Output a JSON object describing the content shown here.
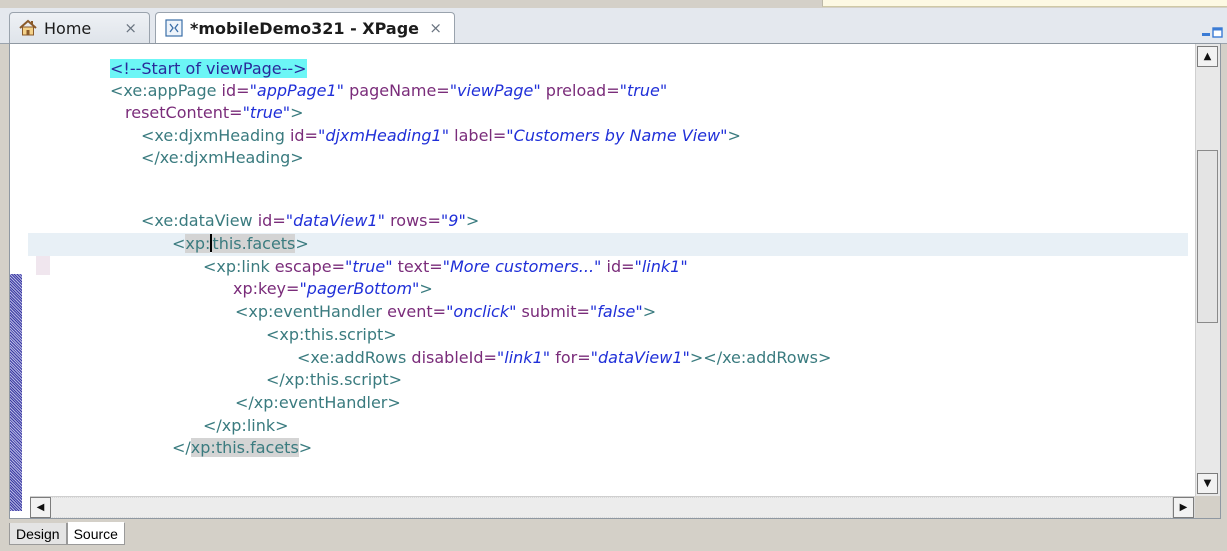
{
  "tabs": [
    {
      "label": "Home",
      "icon": "home-icon",
      "close": "×"
    },
    {
      "label": "*mobileDemo321 - XPage",
      "icon": "xpage-icon",
      "close": "×"
    }
  ],
  "code": {
    "line1": {
      "comment": "<!--Start of viewPage-->"
    },
    "line2": {
      "t1": "<xe:appPage",
      "a1": " id=",
      "v1": "\"appPage1\"",
      "a2": " pageName=",
      "v2": "\"viewPage\"",
      "a3": " preload=",
      "v3": "\"true\""
    },
    "line3": {
      "a1": "resetContent=",
      "v1": "\"true\"",
      "t1": ">"
    },
    "line4": {
      "t1": "<xe:djxmHeading",
      "a1": " id=",
      "v1": "\"djxmHeading1\"",
      "a2": " label=",
      "v2": "\"Customers by Name View\"",
      "t2": ">"
    },
    "line5": {
      "t1": "</xe:djxmHeading>"
    },
    "line7": {
      "t1": "<xe:dataView",
      "a1": " id=",
      "v1": "\"dataView1\"",
      "a2": " rows=",
      "v2": "\"9\"",
      "t2": ">"
    },
    "line8": {
      "t1": "<",
      "h1a": "xp:",
      "h1b": "this.facets",
      "t2": ">"
    },
    "line9": {
      "t1": "<xp:link",
      "a1": " escape=",
      "v1": "\"true\"",
      "a2": " text=",
      "v2": "\"More customers...\"",
      "a3": " id=",
      "v3": "\"link1\""
    },
    "line10": {
      "a1": "xp:key=",
      "v1": "\"pagerBottom\"",
      "t1": ">"
    },
    "line11": {
      "t1": "<xp:eventHandler",
      "a1": " event=",
      "v1": "\"onclick\"",
      "a2": " submit=",
      "v2": "\"false\"",
      "t2": ">"
    },
    "line12": {
      "t1": "<xp:this.script>"
    },
    "line13": {
      "t1": "<xe:addRows",
      "a1": " disableId=",
      "v1": "\"link1\"",
      "a2": " for=",
      "v2": "\"dataView1\"",
      "t2": "></xe:addRows>"
    },
    "line14": {
      "t1": "</xp:this.script>"
    },
    "line15": {
      "t1": "</xp:eventHandler>"
    },
    "line16": {
      "t1": "</xp:link>"
    },
    "line17": {
      "t1": "</",
      "h1": "xp:this.facets",
      "t2": ">"
    }
  },
  "scroll": {
    "up": "▲",
    "down": "▼",
    "left": "◀",
    "right": "▶"
  },
  "bottom_tabs": {
    "design": "Design",
    "source": "Source"
  },
  "colors": {
    "tag": "#3a7b7f",
    "attr": "#7a2c7a",
    "value": "#1f2fd8",
    "comment_bg": "#6cf6f6"
  }
}
